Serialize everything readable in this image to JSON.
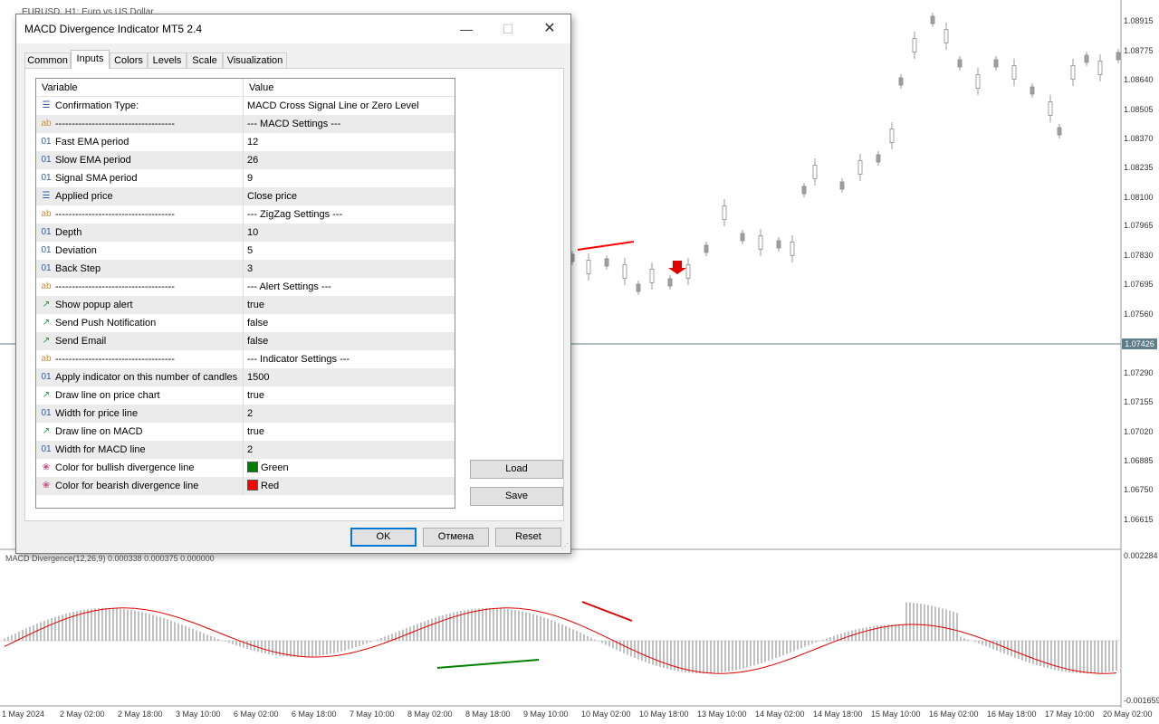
{
  "chart": {
    "window_title": "EURUSD, H1: Euro vs US Dollar",
    "indicator_label": "MACD Divergence(12,26,9) 0.000338 0.000375 0.000000",
    "price_axis": [
      "1.08915",
      "1.08775",
      "1.08640",
      "1.08505",
      "1.08370",
      "1.08235",
      "1.08100",
      "1.07965",
      "1.07830",
      "1.07695",
      "1.07560",
      "1.07290",
      "1.07155",
      "1.07020",
      "1.06885",
      "1.06750",
      "1.06615"
    ],
    "current_price": "1.07426",
    "macd_axis_top": "0.002284",
    "macd_axis_bottom": "-0.001659",
    "date_axis": [
      "1 May 2024",
      "2 May 02:00",
      "2 May 18:00",
      "3 May 10:00",
      "6 May 02:00",
      "6 May 18:00",
      "7 May 10:00",
      "8 May 02:00",
      "8 May 18:00",
      "9 May 10:00",
      "10 May 02:00",
      "10 May 18:00",
      "13 May 10:00",
      "14 May 02:00",
      "14 May 18:00",
      "15 May 10:00",
      "16 May 02:00",
      "16 May 18:00",
      "17 May 10:00",
      "20 May 02:00"
    ]
  },
  "dialog": {
    "title": "MACD Divergence Indicator MT5 2.4",
    "minimize_icon": "—",
    "maximize_icon": "☐",
    "close_icon": "✕",
    "tabs": [
      "Common",
      "Inputs",
      "Colors",
      "Levels",
      "Scale",
      "Visualization"
    ],
    "active_tab": "Inputs",
    "grid": {
      "header": {
        "variable": "Variable",
        "value": "Value"
      },
      "rows": [
        {
          "icon": "enum",
          "variable": "Confirmation Type:",
          "value": "MACD Cross Signal Line or Zero Level"
        },
        {
          "icon": "string",
          "variable": "------------------------------------",
          "value": "--- MACD Settings ---"
        },
        {
          "icon": "int",
          "variable": "Fast EMA period",
          "value": "12"
        },
        {
          "icon": "int",
          "variable": "Slow EMA period",
          "value": "26"
        },
        {
          "icon": "int",
          "variable": "Signal SMA period",
          "value": "9"
        },
        {
          "icon": "enum",
          "variable": "Applied price",
          "value": "Close price"
        },
        {
          "icon": "string",
          "variable": "------------------------------------",
          "value": "--- ZigZag Settings ---"
        },
        {
          "icon": "int",
          "variable": "Depth",
          "value": "10"
        },
        {
          "icon": "int",
          "variable": "Deviation",
          "value": "5"
        },
        {
          "icon": "int",
          "variable": "Back Step",
          "value": "3"
        },
        {
          "icon": "string",
          "variable": "------------------------------------",
          "value": "--- Alert Settings ---"
        },
        {
          "icon": "bool",
          "variable": "Show popup alert",
          "value": "true"
        },
        {
          "icon": "bool",
          "variable": "Send Push Notification",
          "value": "false"
        },
        {
          "icon": "bool",
          "variable": "Send Email",
          "value": "false"
        },
        {
          "icon": "string",
          "variable": "------------------------------------",
          "value": "--- Indicator Settings ---"
        },
        {
          "icon": "int",
          "variable": "Apply indicator on this number of candles",
          "value": "1500"
        },
        {
          "icon": "bool",
          "variable": "Draw line on price chart",
          "value": "true"
        },
        {
          "icon": "int",
          "variable": "Width for price line",
          "value": "2"
        },
        {
          "icon": "bool",
          "variable": "Draw line on MACD",
          "value": "true"
        },
        {
          "icon": "int",
          "variable": "Width for MACD line",
          "value": "2"
        },
        {
          "icon": "color",
          "variable": "Color for bullish divergence line",
          "value": "Green",
          "swatch": "#008000"
        },
        {
          "icon": "color",
          "variable": "Color for bearish divergence line",
          "value": "Red",
          "swatch": "#ff0000"
        }
      ]
    },
    "load_label": "Load",
    "save_label": "Save",
    "ok_label": "OK",
    "cancel_label": "Отмена",
    "reset_label": "Reset"
  },
  "colors": {
    "accent": "#0078d7",
    "macd_signal": "#e00000",
    "histogram": "#c0c0c0",
    "bull_line": "#008000",
    "bear_line": "#ff0000",
    "alt_row": "#ebebeb"
  }
}
